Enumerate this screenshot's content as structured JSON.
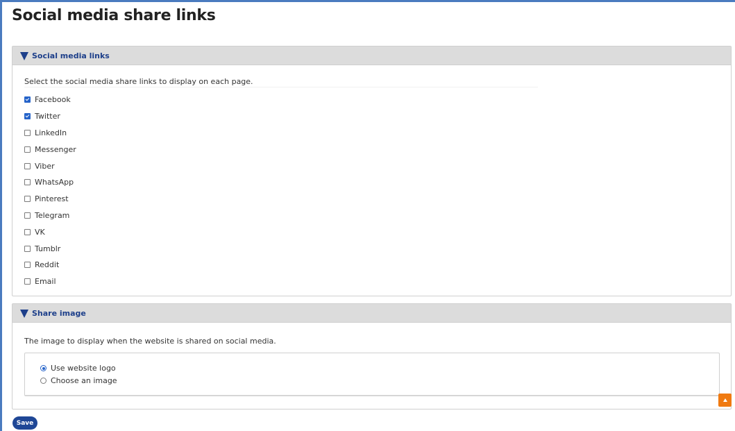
{
  "page": {
    "title": "Social media share links"
  },
  "links_panel": {
    "header": "Social media links",
    "description": "Select the social media share links to display on each page.",
    "options": [
      {
        "label": "Facebook",
        "checked": true
      },
      {
        "label": "Twitter",
        "checked": true
      },
      {
        "label": "LinkedIn",
        "checked": false
      },
      {
        "label": "Messenger",
        "checked": false
      },
      {
        "label": "Viber",
        "checked": false
      },
      {
        "label": "WhatsApp",
        "checked": false
      },
      {
        "label": "Pinterest",
        "checked": false
      },
      {
        "label": "Telegram",
        "checked": false
      },
      {
        "label": "VK",
        "checked": false
      },
      {
        "label": "Tumblr",
        "checked": false
      },
      {
        "label": "Reddit",
        "checked": false
      },
      {
        "label": "Email",
        "checked": false
      }
    ]
  },
  "image_panel": {
    "header": "Share image",
    "description": "The image to display when the website is shared on social media.",
    "options": [
      {
        "label": "Use website logo",
        "selected": true
      },
      {
        "label": "Choose an image",
        "selected": false
      }
    ]
  },
  "actions": {
    "save_label": "Save"
  },
  "colors": {
    "accent": "#1f4796",
    "header_text": "#1d3f8a",
    "checkbox_checked": "#2563c9",
    "scroll_top": "#f07a11",
    "frame_border": "#4a7bbf"
  },
  "icons": {
    "collapse": "triangle-down-icon",
    "scroll_top": "arrow-up-icon"
  }
}
